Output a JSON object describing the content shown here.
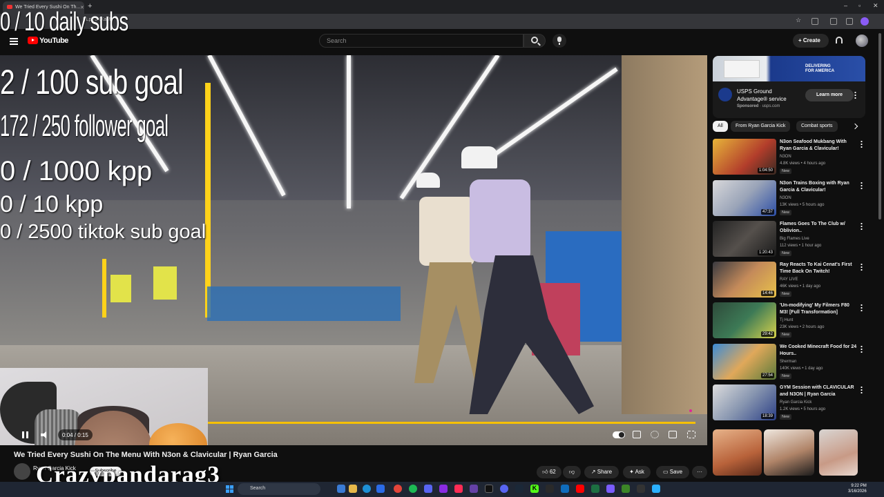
{
  "browser": {
    "tab_title": "We Tried Every Sushi On Th...",
    "url": "ELpV5XXaM"
  },
  "header": {
    "logo_text": "YouTube",
    "search_placeholder": "Search",
    "create_label": "Create"
  },
  "overlay": {
    "line1": "0 / 10 daily subs",
    "line2": "2  / 100 sub goal",
    "line3": "172 / 250 follower goal",
    "line4": "0 / 1000 kpp",
    "line5": "0 / 10 kpp",
    "line6": "0 / 2500 tiktok sub goal",
    "watermark": "Crazypandarag3"
  },
  "player": {
    "time": "0:04 / 0:15",
    "progress_fraction": 0.27
  },
  "video": {
    "title": "We Tried Every Sushi On The Menu With N3on & Clavicular | Ryan Garcia",
    "channel": "Ryan Garcia Kick",
    "subscribe_label": "Subscribe",
    "likes": "62",
    "share_label": "Share",
    "ask_label": "Ask",
    "save_label": "Save"
  },
  "ad": {
    "brand_line1": "DELIVERING",
    "brand_line2": "FOR AMERICA",
    "title": "USPS Ground Advantage® service",
    "sponsored": "Sponsored",
    "domain": "usps.com",
    "cta": "Learn more"
  },
  "chips": [
    "All",
    "From Ryan Garcia Kick",
    "Combat sports"
  ],
  "recommendations": [
    {
      "title": "N3on Seafood Mukbang With Ryan Garcia & Clavicular!",
      "channel": "N3ON",
      "meta": "4.8K views • 4 hours ago",
      "badge": "New",
      "duration": "1:04:50"
    },
    {
      "title": "N3on Trains Boxing with Ryan Garcia & Clavicular!",
      "channel": "N3ON",
      "meta": "13K views • 5 hours ago",
      "badge": "New",
      "duration": "47:37"
    },
    {
      "title": "Flames Goes To The Club w/ Oblivion..",
      "channel": "Big Flames Live",
      "meta": "112 views • 1 hour ago",
      "badge": "New",
      "duration": "1:20:43"
    },
    {
      "title": "Ray Reacts To Kai Cenat's First Time Back On Twitch!",
      "channel": "RAY LIVE",
      "meta": "46K views • 1 day ago",
      "badge": "New",
      "duration": "14:46"
    },
    {
      "title": "'Un-modifying' My Filmers F80 M3! [Full Transformation]",
      "channel": "Tj Hunt",
      "meta": "23K views • 2 hours ago",
      "badge": "New",
      "duration": "29:42"
    },
    {
      "title": "We Cooked Minecraft Food for 24 Hours..",
      "channel": "Sherman",
      "meta": "140K views • 1 day ago",
      "badge": "New",
      "duration": "27:54"
    },
    {
      "title": "GYM Session with CLAVICULAR and N3ON | Ryan Garcia",
      "channel": "Ryan Garcia Kick",
      "meta": "1.2K views • 5 hours ago",
      "badge": "New",
      "duration": "18:39"
    }
  ],
  "taskbar": {
    "search_label": "Search",
    "time": "9:22 PM",
    "date": "3/16/2026"
  },
  "colors": {
    "progress": "#f6c000",
    "youtube_red": "#ff0000"
  }
}
